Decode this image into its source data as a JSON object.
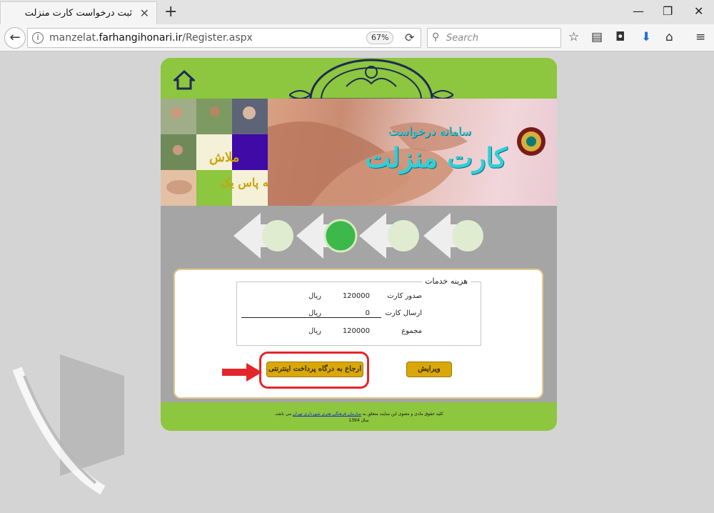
{
  "browser": {
    "tab_title": "ثبت درخواست کارت منزلت",
    "url_prefix": "manzelat.",
    "url_domain": "farhangihonari.ir",
    "url_path": "/Register.aspx",
    "zoom": "67%",
    "search_placeholder": "Search"
  },
  "banner": {
    "title": "کارت منزلت",
    "subtitle": "سامانه درخواست",
    "collage_line1": "ملاش",
    "collage_line2": "به پاس یک"
  },
  "services": {
    "legend": "هزینه خدمات",
    "rows": [
      {
        "label": "صدور کارت",
        "amount": "120000",
        "unit": "ریال"
      },
      {
        "label": "ارسال کارت",
        "amount": "0",
        "unit": "ریال"
      },
      {
        "label": "مجموع",
        "amount": "120000",
        "unit": "ریال"
      }
    ]
  },
  "buttons": {
    "pay": "ارجاع به درگاه پرداخت اینترنتی",
    "edit": "ویرایش"
  },
  "footer": {
    "line1_pre": "کلیه حقوق مادی و معنوی این سایت متعلق به",
    "line1_link": "سازمان فرهنگی هنری شهرداری تهران",
    "line1_post": "می باشد.",
    "line2": "سال 1394"
  },
  "colors": {
    "site_green": "#8dc63f",
    "button_gold": "#d9a808",
    "highlight_red": "#e3262b"
  }
}
